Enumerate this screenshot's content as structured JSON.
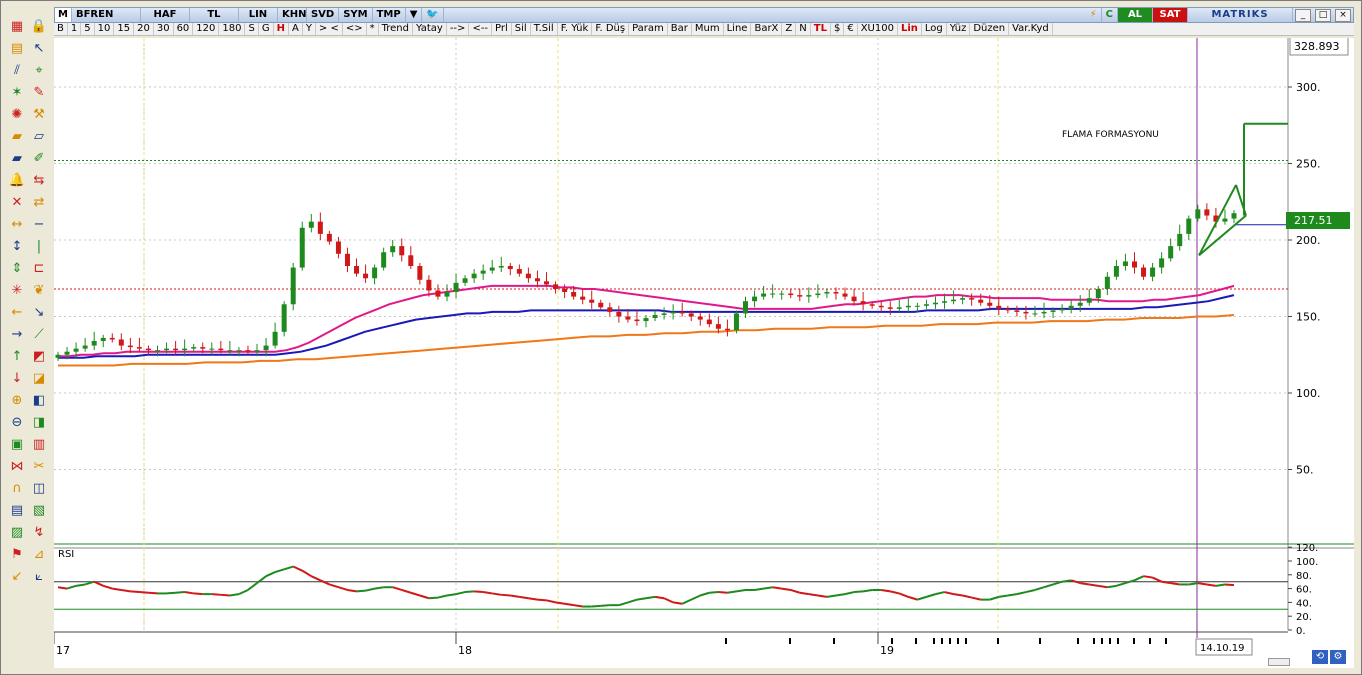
{
  "window": {
    "m_label": "M",
    "symbol": "BFREN",
    "fields": [
      "HAF",
      "TL",
      "LIN",
      "KHN",
      "SVD",
      "SYM",
      "TMP"
    ],
    "al_label": "AL",
    "sat_label": "SAT",
    "brand": "MATRIKS",
    "win_buttons": [
      "_",
      "□",
      "×"
    ]
  },
  "toolbar": {
    "items": [
      "B",
      "1",
      "5",
      "10",
      "15",
      "20",
      "30",
      "60",
      "120",
      "180",
      "S",
      "G",
      "H",
      "A",
      "Y",
      ">  <",
      "<>",
      "*",
      "Trend",
      "Yatay",
      "-->",
      "<--",
      "Prl",
      "Sil",
      "T.Sil",
      "F. Yük",
      "F. Düş",
      "Param",
      "Bar",
      "Mum",
      "Line",
      "BarX",
      "Z",
      "N",
      "TL",
      "$",
      "€",
      "XU100",
      "Lin",
      "Log",
      "Yüz",
      "Düzen",
      "Var.Kyd"
    ],
    "red_items": [
      "H",
      "TL",
      "Lin"
    ]
  },
  "toolbox": {
    "icons": [
      "grid-icon",
      "lock-icon",
      "bars-icon",
      "cursor-arrow-icon",
      "parallel-lines-icon",
      "crosshair-icon",
      "fan-icon",
      "pencil-icon",
      "gear-draw-icon",
      "shovel-icon",
      "folder-icon",
      "ruler-icon",
      "folder-line-icon",
      "pen-green-icon",
      "bell-icon",
      "arrows-horizontal-icon",
      "cross-arrows-icon",
      "arrows-swap-icon",
      "expand-horizontal-icon",
      "minus-icon",
      "expand-vertical-icon",
      "pipe-icon",
      "expand-vertical2-icon",
      "bracket-icon",
      "atom-icon",
      "leaf-icon",
      "arrow-left-icon",
      "diagonal-arrow-icon",
      "arrow-right-icon",
      "tilted-line-icon",
      "arrow-up-icon",
      "chart-add-icon",
      "arrow-down-icon",
      "chart-remove-icon",
      "zoom-in-icon",
      "chart-up-icon",
      "zoom-out-icon",
      "chart-down-icon",
      "frame-icon",
      "bars-red-icon",
      "bowtie-icon",
      "scissors-icon",
      "magnet-icon",
      "chart-diag-icon",
      "stack-icon",
      "doc-icon",
      "measure-icon",
      "zigzag-icon",
      "flag-icon",
      "pin-icon",
      "down-chart-icon",
      "graph-icon"
    ]
  },
  "chart": {
    "annotation": "FLAMA  FORMASYONU",
    "last_price_label": "217.51",
    "top_price_label": "328.893",
    "price_axis_ticks": [
      "300.",
      "250.",
      "200.",
      "150.",
      "100.",
      "50."
    ],
    "rsi_label": "RSI",
    "rsi_axis_ticks": [
      "120.",
      "100.",
      "80.",
      "60.",
      "40.",
      "20.",
      "0."
    ],
    "time_labels": [
      "17",
      "18",
      "19"
    ],
    "cursor_date": "14.10.19",
    "colors": {
      "up_candle": "#1e8a1e",
      "down_candle": "#d01818",
      "ma_fast": "#e0198a",
      "ma_mid": "#1a1ab8",
      "ma_slow": "#f07818",
      "pennant": "#1e8a1e",
      "cursor_line": "#8a2a9a",
      "rsi_line_up": "#1e8a1e",
      "rsi_line_down": "#d01818"
    }
  },
  "chart_data": {
    "type": "candlestick",
    "title": "BFREN",
    "ylim": [
      0,
      328.893
    ],
    "y_log": false,
    "price_grid": true,
    "horizontal_levels": [
      {
        "value": 252,
        "style": "dotted",
        "color": "#1e8a1e"
      },
      {
        "value": 168,
        "style": "dotted",
        "color": "#d01818"
      },
      {
        "value": 210,
        "style": "solid",
        "color": "#1a1ab8"
      }
    ],
    "target_level": 276,
    "last_price": 217.51,
    "closes": [
      125,
      127,
      129,
      131,
      134,
      136,
      135,
      131,
      130,
      129,
      128,
      128,
      129,
      128,
      129,
      130,
      129,
      129,
      128,
      128,
      128,
      127,
      128,
      131,
      140,
      158,
      182,
      208,
      212,
      204,
      199,
      191,
      183,
      178,
      175,
      182,
      192,
      196,
      190,
      183,
      174,
      167,
      163,
      166,
      172,
      175,
      178,
      180,
      182,
      183,
      181,
      178,
      175,
      173,
      171,
      168,
      166,
      163,
      161,
      159,
      156,
      153,
      150,
      148,
      147,
      149,
      151,
      152,
      153,
      152,
      150,
      148,
      145,
      142,
      141,
      152,
      160,
      163,
      165,
      165,
      165,
      164,
      163,
      164,
      165,
      166,
      165,
      163,
      160,
      158,
      157,
      156,
      155,
      156,
      157,
      157,
      158,
      159,
      160,
      161,
      162,
      161,
      159,
      157,
      155,
      154,
      153,
      152,
      152,
      153,
      154,
      155,
      157,
      159,
      162,
      168,
      176,
      183,
      186,
      182,
      176,
      182,
      188,
      196,
      204,
      214,
      220,
      216,
      212,
      214,
      217.51
    ],
    "rsi": [
      62,
      60,
      64,
      66,
      70,
      64,
      60,
      58,
      56,
      55,
      54,
      53,
      53,
      54,
      55,
      53,
      52,
      52,
      51,
      50,
      52,
      58,
      68,
      78,
      84,
      88,
      92,
      86,
      78,
      72,
      66,
      62,
      58,
      56,
      57,
      60,
      62,
      62,
      58,
      54,
      50,
      46,
      47,
      50,
      52,
      55,
      56,
      55,
      53,
      51,
      50,
      48,
      46,
      44,
      43,
      40,
      38,
      36,
      34,
      34,
      35,
      36,
      36,
      40,
      44,
      46,
      48,
      46,
      40,
      38,
      44,
      50,
      54,
      55,
      54,
      56,
      58,
      58,
      60,
      62,
      60,
      58,
      54,
      52,
      50,
      48,
      50,
      52,
      55,
      56,
      58,
      58,
      56,
      53,
      48,
      44,
      48,
      52,
      55,
      52,
      50,
      47,
      44,
      44,
      48,
      50,
      52,
      55,
      58,
      62,
      66,
      70,
      72,
      68,
      66,
      64,
      62,
      64,
      68,
      72,
      78,
      76,
      70,
      68,
      66,
      66,
      68,
      66,
      64,
      66,
      65
    ],
    "ma_fast": [
      124,
      124,
      125,
      125,
      126,
      126,
      127,
      127,
      127,
      127,
      127,
      127,
      127,
      127,
      127,
      127,
      127,
      127,
      127,
      127,
      128,
      130,
      133,
      137,
      141,
      145,
      149,
      152,
      155,
      158,
      160,
      162,
      164,
      165,
      166,
      167,
      168,
      169,
      170,
      170,
      170,
      170,
      170,
      170,
      169,
      169,
      168,
      168,
      167,
      166,
      165,
      164,
      163,
      162,
      161,
      160,
      159,
      158,
      157,
      156,
      155,
      155,
      155,
      155,
      155,
      155,
      155,
      156,
      157,
      158,
      158,
      159,
      160,
      161,
      162,
      163,
      163,
      164,
      164,
      164,
      163,
      163,
      162,
      162,
      162,
      162,
      162,
      161,
      161,
      161,
      161,
      161,
      160,
      160,
      160,
      160,
      161,
      161,
      162,
      163,
      164,
      166,
      168,
      170
    ],
    "ma_mid": [
      123,
      123,
      123,
      124,
      124,
      124,
      124,
      125,
      125,
      125,
      125,
      125,
      125,
      125,
      125,
      125,
      125,
      125,
      126,
      127,
      129,
      131,
      134,
      137,
      140,
      142,
      144,
      146,
      148,
      149,
      150,
      151,
      152,
      152,
      153,
      153,
      153,
      154,
      154,
      154,
      154,
      154,
      154,
      154,
      154,
      154,
      154,
      154,
      153,
      153,
      153,
      153,
      153,
      153,
      153,
      153,
      153,
      153,
      153,
      153,
      153,
      153,
      153,
      153,
      153,
      153,
      153,
      153,
      154,
      154,
      154,
      154,
      154,
      155,
      155,
      155,
      155,
      155,
      155,
      155,
      155,
      155,
      155,
      155,
      155,
      156,
      156,
      157,
      158,
      159,
      160,
      162,
      164
    ],
    "ma_slow": [
      118,
      118,
      118,
      118,
      119,
      119,
      119,
      119,
      120,
      120,
      120,
      121,
      121,
      122,
      122,
      123,
      124,
      125,
      126,
      127,
      128,
      129,
      130,
      131,
      132,
      133,
      134,
      135,
      136,
      137,
      137,
      138,
      138,
      139,
      139,
      140,
      140,
      141,
      141,
      142,
      142,
      142,
      143,
      143,
      143,
      144,
      144,
      144,
      145,
      145,
      145,
      146,
      146,
      146,
      147,
      147,
      147,
      148,
      148,
      149,
      149,
      149,
      150,
      150,
      151
    ],
    "rsi_levels": [
      70,
      30
    ],
    "x_labels": [
      "17",
      "18",
      "19"
    ],
    "cursor_label": "14.10.19"
  }
}
